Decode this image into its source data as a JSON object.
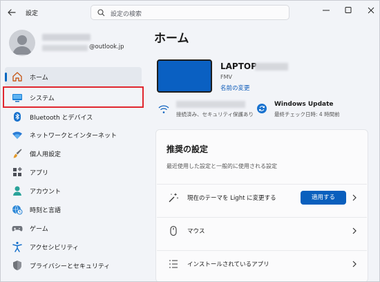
{
  "window": {
    "title": "設定"
  },
  "search": {
    "placeholder": "設定の検索"
  },
  "profile": {
    "email": "@outlook.jp"
  },
  "sidebar": {
    "items": [
      {
        "label": "ホーム",
        "icon": "home-icon"
      },
      {
        "label": "システム",
        "icon": "system-icon"
      },
      {
        "label": "Bluetooth とデバイス",
        "icon": "bluetooth-icon"
      },
      {
        "label": "ネットワークとインターネット",
        "icon": "wifi-icon"
      },
      {
        "label": "個人用設定",
        "icon": "brush-icon"
      },
      {
        "label": "アプリ",
        "icon": "apps-icon"
      },
      {
        "label": "アカウント",
        "icon": "account-icon"
      },
      {
        "label": "時刻と言語",
        "icon": "globe-clock-icon"
      },
      {
        "label": "ゲーム",
        "icon": "gamepad-icon"
      },
      {
        "label": "アクセシビリティ",
        "icon": "accessibility-icon"
      },
      {
        "label": "プライバシーとセキュリティ",
        "icon": "shield-icon"
      }
    ]
  },
  "main": {
    "title": "ホーム",
    "device": {
      "name": "LAPTOP-",
      "model": "FMV",
      "rename": "名前の変更"
    },
    "network": {
      "status": "接続済み、セキュリティ保護あり"
    },
    "update": {
      "title": "Windows Update",
      "subtitle": "最終チェック日時: 4 時間前"
    },
    "recommended": {
      "title": "推奨の設定",
      "description": "最近使用した設定と一般的に使用される設定",
      "items": [
        {
          "label": "現在のテーマを Light に変更する",
          "button": "適用する",
          "icon": "theme-sparkle-icon"
        },
        {
          "label": "マウス",
          "icon": "mouse-icon"
        },
        {
          "label": "インストールされているアプリ",
          "icon": "list-icon"
        }
      ]
    }
  },
  "colors": {
    "accent": "#0a5fbd",
    "highlight": "#e0262e"
  }
}
